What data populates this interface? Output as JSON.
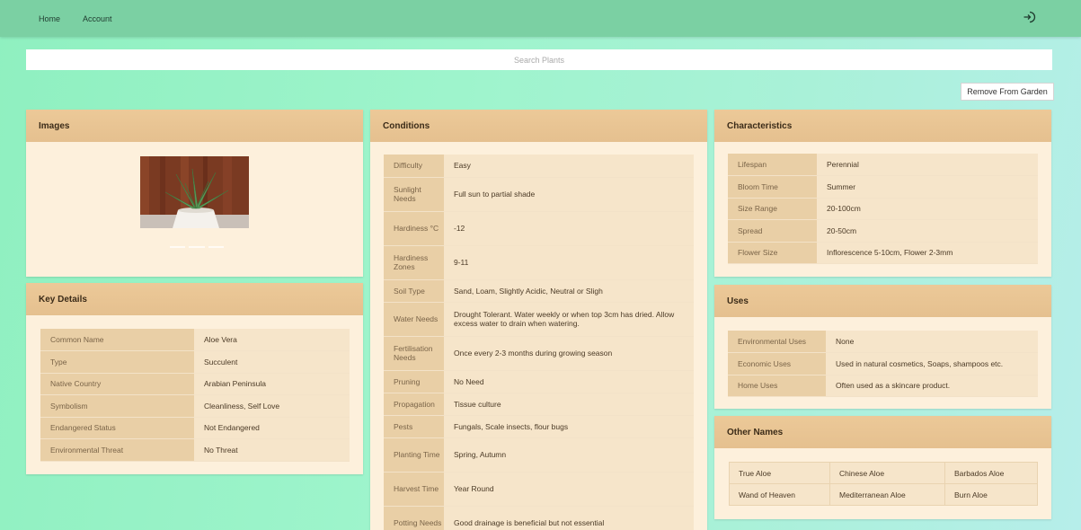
{
  "nav": {
    "home": "Home",
    "account": "Account"
  },
  "icons": {
    "logout": "logout-icon"
  },
  "search": {
    "placeholder": "Search Plants",
    "value": ""
  },
  "actions": {
    "remove": "Remove From Garden"
  },
  "colors": {
    "nav": "#7bd0a3",
    "card_header": "#e8c592",
    "card_body": "#fdf0dc",
    "key_cell": "#e9cfa6",
    "value_cell": "#f6e5ca"
  },
  "images": {
    "title": "Images",
    "image_alt": "Aloe vera plant in white pot"
  },
  "key_details": {
    "title": "Key Details",
    "rows": [
      {
        "k": "Common Name",
        "v": "Aloe Vera"
      },
      {
        "k": "Type",
        "v": "Succulent"
      },
      {
        "k": "Native Country",
        "v": "Arabian Peninsula"
      },
      {
        "k": "Symbolism",
        "v": "Cleanliness, Self Love"
      },
      {
        "k": "Endangered Status",
        "v": "Not Endangered"
      },
      {
        "k": "Environmental Threat",
        "v": "No Threat"
      }
    ]
  },
  "conditions": {
    "title": "Conditions",
    "rows": [
      {
        "k": "Difficulty",
        "v": "Easy"
      },
      {
        "k": "Sunlight Needs",
        "v": "Full sun to partial shade"
      },
      {
        "k": "Hardiness °C",
        "v": "-12"
      },
      {
        "k": "Hardiness Zones",
        "v": "9-11"
      },
      {
        "k": "Soil Type",
        "v": "Sand, Loam, Slightly Acidic, Neutral or Sligh"
      },
      {
        "k": "Water Needs",
        "v": "Drought Tolerant. Water weekly or when top 3cm has dried. Allow excess water to drain when watering."
      },
      {
        "k": "Fertilisation Needs",
        "v": "Once every 2-3 months during growing season"
      },
      {
        "k": "Pruning",
        "v": "No Need"
      },
      {
        "k": "Propagation",
        "v": "Tissue culture"
      },
      {
        "k": "Pests",
        "v": "Fungals, Scale insects, flour bugs"
      },
      {
        "k": "Planting Time",
        "v": "Spring, Autumn"
      },
      {
        "k": "Harvest Time",
        "v": "Year Round"
      },
      {
        "k": "Potting Needs",
        "v": "Good drainage is beneficial but not essential"
      }
    ]
  },
  "characteristics": {
    "title": "Characteristics",
    "rows": [
      {
        "k": "Lifespan",
        "v": "Perennial"
      },
      {
        "k": "Bloom Time",
        "v": "Summer"
      },
      {
        "k": "Size Range",
        "v": "20-100cm"
      },
      {
        "k": "Spread",
        "v": "20-50cm"
      },
      {
        "k": "Flower Size",
        "v": "Inflorescence 5-10cm, Flower 2-3mm"
      }
    ]
  },
  "uses": {
    "title": "Uses",
    "rows": [
      {
        "k": "Environmental Uses",
        "v": "None"
      },
      {
        "k": "Economic Uses",
        "v": "Used in natural cosmetics, Soaps, shampoos etc."
      },
      {
        "k": "Home Uses",
        "v": "Often used as a skincare product."
      }
    ]
  },
  "other_names": {
    "title": "Other Names",
    "rows": [
      [
        "True Aloe",
        "Chinese Aloe",
        "Barbados Aloe"
      ],
      [
        "Wand of Heaven",
        "Mediterranean Aloe",
        "Burn Aloe"
      ]
    ]
  }
}
